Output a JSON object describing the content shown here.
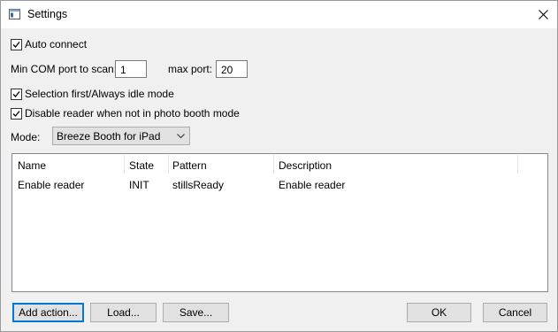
{
  "window": {
    "title": "Settings"
  },
  "options": {
    "auto_connect": {
      "label": "Auto connect",
      "checked": true
    },
    "min_com_label": "Min COM port to scan:",
    "min_com_value": "1",
    "max_port_label": "max port:",
    "max_port_value": "20",
    "selection_first": {
      "label": "Selection first/Always idle mode",
      "checked": true
    },
    "disable_reader": {
      "label": "Disable reader when not in photo booth mode",
      "checked": true
    },
    "mode_label": "Mode:",
    "mode_value": "Breeze Booth for iPad"
  },
  "actions_table": {
    "columns": [
      "Name",
      "State",
      "Pattern",
      "Description"
    ],
    "rows": [
      [
        "Enable reader",
        "INIT",
        "stillsReady",
        "Enable reader"
      ]
    ]
  },
  "buttons": {
    "add_action": "Add action...",
    "load": "Load...",
    "save": "Save...",
    "ok": "OK",
    "cancel": "Cancel"
  }
}
